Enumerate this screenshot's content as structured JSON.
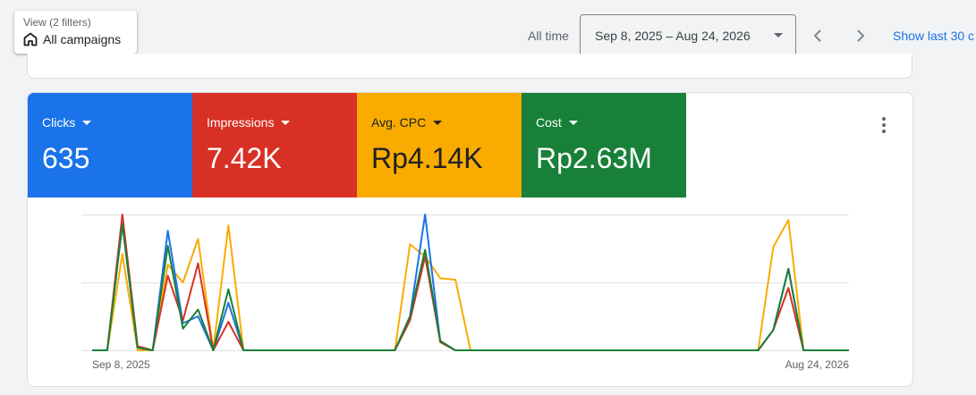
{
  "view": {
    "sub_label": "View (2 filters)",
    "main_label": "All campaigns"
  },
  "date": {
    "all_time_label": "All time",
    "range": "Sep 8, 2025 – Aug 24, 2026",
    "show_last_label": "Show last 30 c"
  },
  "metrics": [
    {
      "label": "Clicks",
      "value": "635",
      "color": "#1a73e8"
    },
    {
      "label": "Impressions",
      "value": "7.42K",
      "color": "#d93025"
    },
    {
      "label": "Avg. CPC",
      "value": "Rp4.14K",
      "color": "#f9ab00"
    },
    {
      "label": "Cost",
      "value": "Rp2.63M",
      "color": "#188038"
    }
  ],
  "chart_data": {
    "type": "line",
    "x_start_label": "Sep 8, 2025",
    "x_end_label": "Aug 24, 2026",
    "normalized": true,
    "grid": true,
    "x": [
      0,
      1,
      2,
      3,
      4,
      5,
      6,
      7,
      8,
      9,
      10,
      11,
      12,
      13,
      14,
      15,
      16,
      17,
      18,
      19,
      20,
      21,
      22,
      23,
      24,
      25,
      26,
      27,
      28,
      29,
      30,
      31,
      32,
      33,
      34,
      35,
      36,
      37,
      38,
      39,
      40,
      41,
      42,
      43,
      44,
      45,
      46,
      47,
      48,
      49,
      50
    ],
    "series": [
      {
        "key": "clicks",
        "color": "#1a73e8",
        "values": [
          0,
          0,
          0.93,
          0.02,
          0,
          0.88,
          0.2,
          0.25,
          0,
          0.35,
          0,
          0,
          0,
          0,
          0,
          0,
          0,
          0,
          0,
          0,
          0,
          0.25,
          1.0,
          0.06,
          0,
          0,
          0,
          0,
          0,
          0,
          0,
          0,
          0,
          0,
          0,
          0,
          0,
          0,
          0,
          0,
          0,
          0,
          0,
          0,
          0,
          0.15,
          0.6,
          0,
          0,
          0,
          0
        ]
      },
      {
        "key": "impressions",
        "color": "#d93025",
        "values": [
          0,
          0,
          1.0,
          0.03,
          0,
          0.55,
          0.22,
          0.64,
          0,
          0.21,
          0,
          0,
          0,
          0,
          0,
          0,
          0,
          0,
          0,
          0,
          0,
          0.22,
          0.69,
          0.06,
          0,
          0,
          0,
          0,
          0,
          0,
          0,
          0,
          0,
          0,
          0,
          0,
          0,
          0,
          0,
          0,
          0,
          0,
          0,
          0,
          0,
          0.15,
          0.46,
          0,
          0,
          0,
          0
        ]
      },
      {
        "key": "avg_cpc",
        "color": "#f9ab00",
        "values": [
          0,
          0,
          0.71,
          0,
          0,
          0.63,
          0.5,
          0.82,
          0,
          0.92,
          0,
          0,
          0,
          0,
          0,
          0,
          0,
          0,
          0,
          0,
          0,
          0.78,
          0.69,
          0.53,
          0.52,
          0,
          0,
          0,
          0,
          0,
          0,
          0,
          0,
          0,
          0,
          0,
          0,
          0,
          0,
          0,
          0,
          0,
          0,
          0,
          0,
          0.76,
          0.96,
          0,
          0,
          0,
          0
        ]
      },
      {
        "key": "cost",
        "color": "#188038",
        "values": [
          0,
          0,
          0.93,
          0.02,
          0,
          0.77,
          0.16,
          0.3,
          0,
          0.45,
          0,
          0,
          0,
          0,
          0,
          0,
          0,
          0,
          0,
          0,
          0,
          0.25,
          0.74,
          0.07,
          0,
          0,
          0,
          0,
          0,
          0,
          0,
          0,
          0,
          0,
          0,
          0,
          0,
          0,
          0,
          0,
          0,
          0,
          0,
          0,
          0,
          0.15,
          0.6,
          0,
          0,
          0,
          0
        ]
      }
    ]
  }
}
